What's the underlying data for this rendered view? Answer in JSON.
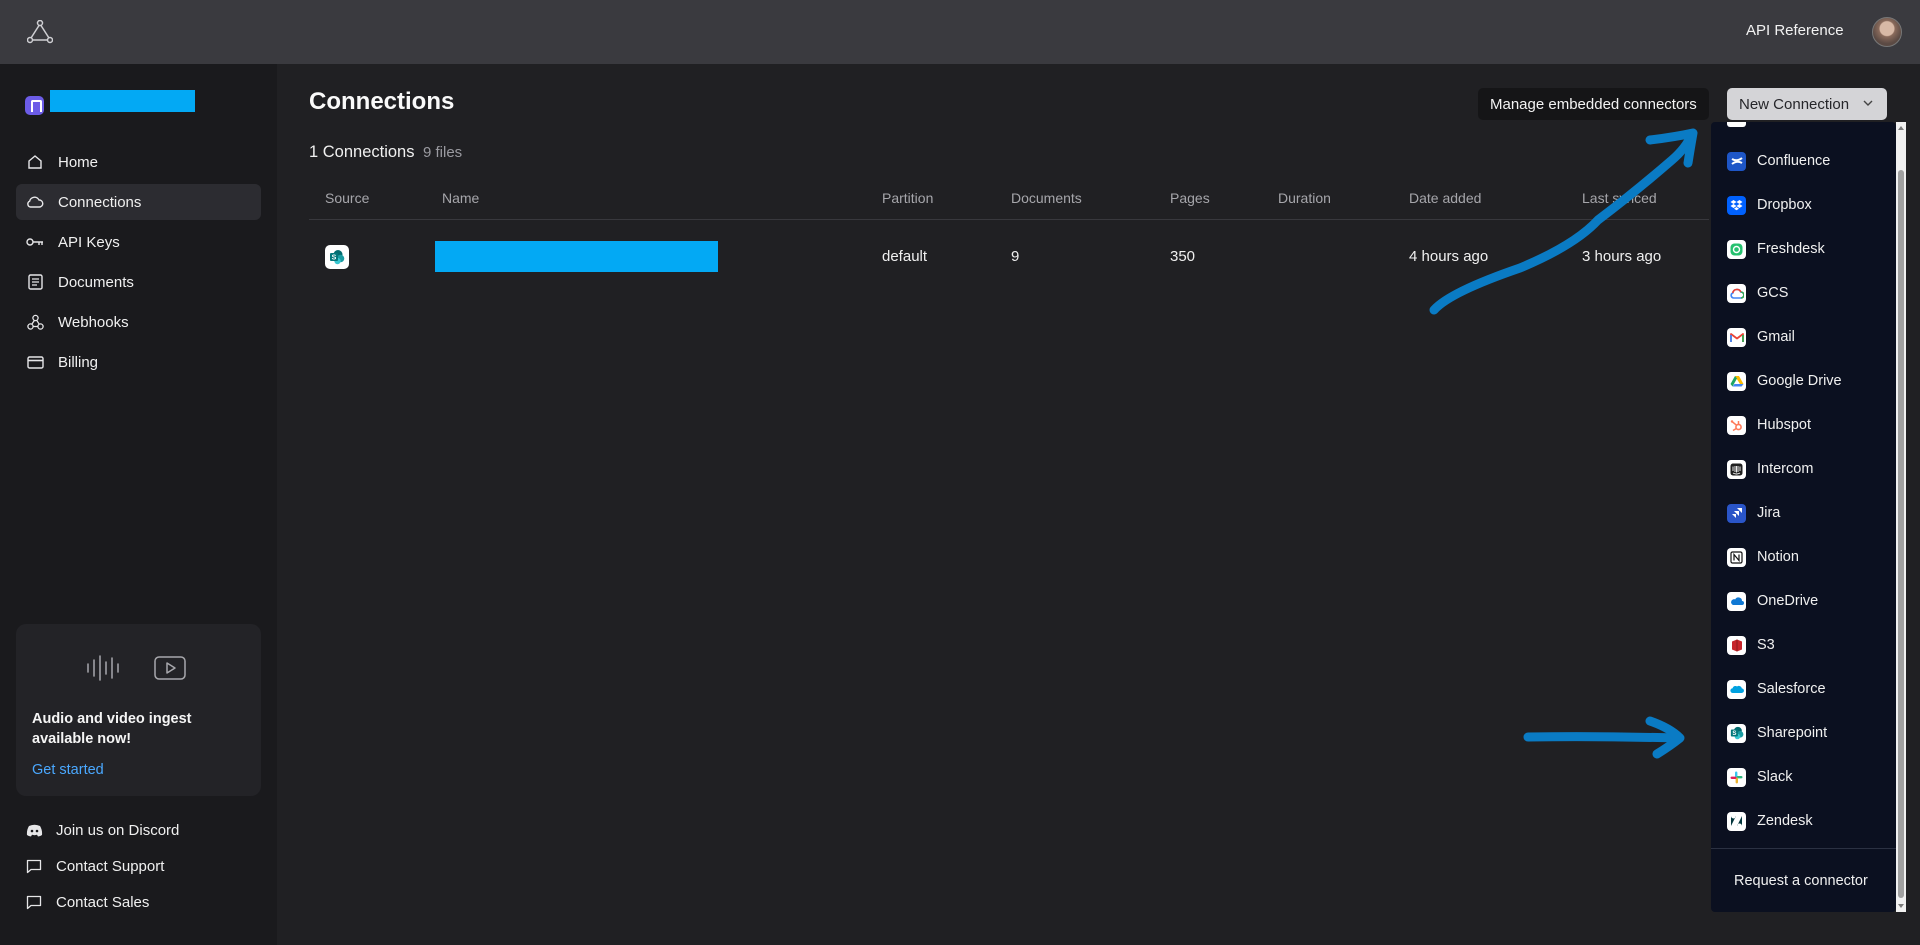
{
  "topbar": {
    "api_reference": "API Reference",
    "logo_icon": "triangle-nodes-icon"
  },
  "sidebar": {
    "items": [
      {
        "label": "Home",
        "icon": "home-icon"
      },
      {
        "label": "Connections",
        "icon": "cloud-icon",
        "active": true
      },
      {
        "label": "API Keys",
        "icon": "key-icon"
      },
      {
        "label": "Documents",
        "icon": "document-icon"
      },
      {
        "label": "Webhooks",
        "icon": "webhook-icon"
      },
      {
        "label": "Billing",
        "icon": "credit-card-icon"
      }
    ],
    "promo": {
      "title": "Audio and video ingest available now!",
      "link": "Get started"
    },
    "footer": [
      {
        "label": "Join us on Discord",
        "icon": "discord-icon"
      },
      {
        "label": "Contact Support",
        "icon": "chat-icon"
      },
      {
        "label": "Contact Sales",
        "icon": "chat-icon"
      }
    ]
  },
  "main": {
    "title": "Connections",
    "manage_button": "Manage embedded connectors",
    "new_button": "New Connection",
    "connections_count": "1 Connections",
    "files_count": "9 files",
    "columns": [
      "Source",
      "Name",
      "Partition",
      "Documents",
      "Pages",
      "Duration",
      "Date added",
      "Last synced"
    ],
    "rows": [
      {
        "source_icon": "sharepoint-icon",
        "partition": "default",
        "documents": "9",
        "pages": "350",
        "duration": "",
        "date_added": "4 hours ago",
        "last_synced": "3 hours ago"
      }
    ]
  },
  "dropdown": {
    "items": [
      {
        "label": "Confluence",
        "icon": "confluence-icon",
        "color": "#1e56c7"
      },
      {
        "label": "Dropbox",
        "icon": "dropbox-icon",
        "color": "#0061fe"
      },
      {
        "label": "Freshdesk",
        "icon": "freshdesk-icon",
        "color": "#25c16f"
      },
      {
        "label": "GCS",
        "icon": "gcs-icon",
        "color": "#4285f4"
      },
      {
        "label": "Gmail",
        "icon": "gmail-icon",
        "color": "#ea4335"
      },
      {
        "label": "Google Drive",
        "icon": "google-drive-icon",
        "color": "#1fa463"
      },
      {
        "label": "Hubspot",
        "icon": "hubspot-icon",
        "color": "#ff7a59"
      },
      {
        "label": "Intercom",
        "icon": "intercom-icon",
        "color": "#1f1f1f"
      },
      {
        "label": "Jira",
        "icon": "jira-icon",
        "color": "#2684ff"
      },
      {
        "label": "Notion",
        "icon": "notion-icon",
        "color": "#111111"
      },
      {
        "label": "OneDrive",
        "icon": "onedrive-icon",
        "color": "#0f78d4"
      },
      {
        "label": "S3",
        "icon": "s3-icon",
        "color": "#c7252b"
      },
      {
        "label": "Salesforce",
        "icon": "salesforce-icon",
        "color": "#00a1e0"
      },
      {
        "label": "Sharepoint",
        "icon": "sharepoint-icon",
        "color": "#038387"
      },
      {
        "label": "Slack",
        "icon": "slack-icon",
        "color": "#e01e5a"
      },
      {
        "label": "Zendesk",
        "icon": "zendesk-icon",
        "color": "#03363d"
      }
    ],
    "request": "Request a connector"
  },
  "colors": {
    "accent_link": "#4aa8ff",
    "redaction": "#03a9f4",
    "annotation_arrow": "#0a7bc4"
  }
}
